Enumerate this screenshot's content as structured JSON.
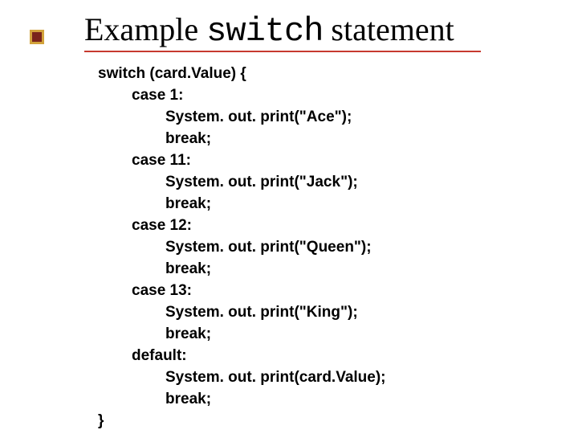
{
  "title": {
    "pre": "Example ",
    "mono": "switch",
    "post": " statement"
  },
  "code": {
    "l1": "switch (card.Value) {",
    "l2": "case 1:",
    "l3": "System. out. print(\"Ace\");",
    "l4": "break;",
    "l5": "case 11:",
    "l6": "System. out. print(\"Jack\");",
    "l7": "break;",
    "l8": "case 12:",
    "l9": "System. out. print(\"Queen\");",
    "l10": "break;",
    "l11": "case 13:",
    "l12": "System. out. print(\"King\");",
    "l13": "break;",
    "l14": "default:",
    "l15": "System. out. print(card.Value);",
    "l16": "break;",
    "l17": "}"
  }
}
